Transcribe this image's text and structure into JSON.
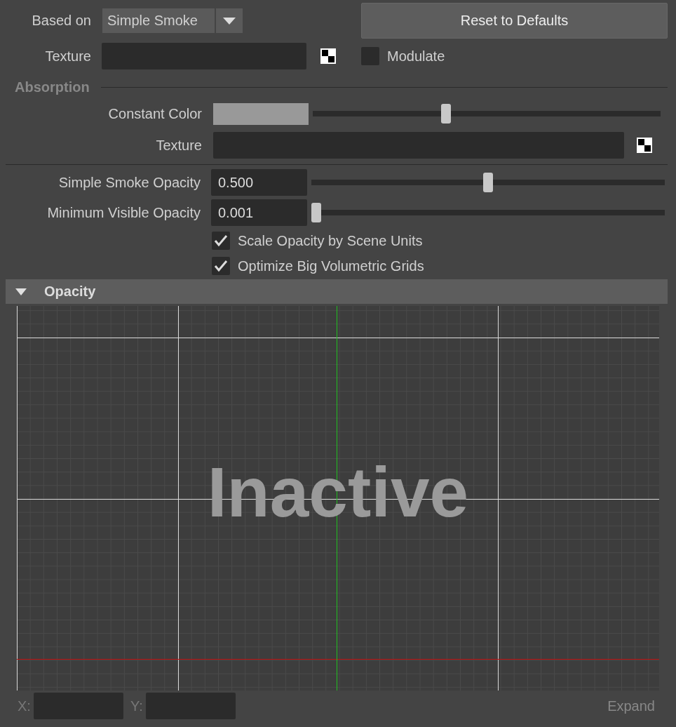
{
  "based_on": {
    "label": "Based on",
    "value": "Simple Smoke"
  },
  "reset_button": "Reset to Defaults",
  "texture": {
    "label": "Texture"
  },
  "modulate": {
    "label": "Modulate",
    "checked": false
  },
  "absorption": {
    "title": "Absorption",
    "constant_color": {
      "label": "Constant Color",
      "color": "#999999",
      "level": 0.38
    },
    "texture": {
      "label": "Texture"
    }
  },
  "opacity_fields": [
    {
      "label": "Simple Smoke Opacity",
      "value": "0.500",
      "level": 0.5
    },
    {
      "label": "Minimum Visible Opacity",
      "value": "0.001",
      "level": 0
    }
  ],
  "options": [
    {
      "label": "Scale Opacity by Scene Units",
      "checked": true
    },
    {
      "label": "Optimize Big Volumetric Grids",
      "checked": true
    }
  ],
  "opacity_section": {
    "title": "Opacity",
    "expanded": true,
    "graph": {
      "overlay": "Inactive"
    }
  },
  "coordinates": [
    {
      "label": "X:"
    },
    {
      "label": "Y:"
    }
  ],
  "expand_button": "Expand"
}
